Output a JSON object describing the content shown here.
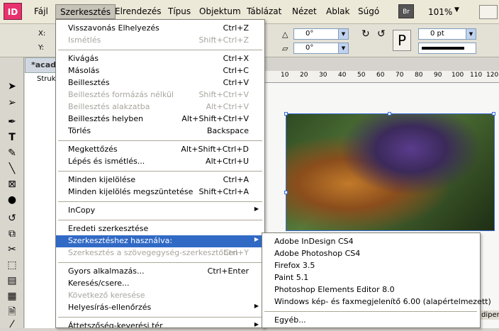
{
  "app": {
    "logo": "ID"
  },
  "menubar": {
    "items": [
      "Fájl",
      "Szerkesztés",
      "Elrendezés",
      "Típus",
      "Objektum",
      "Táblázat",
      "Nézet",
      "Ablak",
      "Súgó"
    ],
    "bridge_label": "Br",
    "zoom": "101%"
  },
  "control_panel": {
    "x_label": "X:",
    "y_label": "Y:",
    "angle1": "0°",
    "angle2": "0°",
    "stroke_weight": "0 pt"
  },
  "document": {
    "tab_title": "*acad",
    "panel_label": "Strukt"
  },
  "ruler": {
    "marks": [
      "10",
      "20",
      "30",
      "40",
      "50",
      "60",
      "70",
      "80",
      "90",
      "100",
      "110",
      "120"
    ]
  },
  "edit_menu": {
    "items": [
      {
        "label": "Visszavonás Elhelyezés",
        "shortcut": "Ctrl+Z",
        "disabled": false
      },
      {
        "label": "Ismétlés",
        "shortcut": "Shift+Ctrl+Z",
        "disabled": true
      },
      {
        "label": "Kivágás",
        "shortcut": "Ctrl+X",
        "disabled": false
      },
      {
        "label": "Másolás",
        "shortcut": "Ctrl+C",
        "disabled": false
      },
      {
        "label": "Beillesztés",
        "shortcut": "Ctrl+V",
        "disabled": false
      },
      {
        "label": "Beillesztés formázás nélkül",
        "shortcut": "Shift+Ctrl+V",
        "disabled": true
      },
      {
        "label": "Beillesztés alakzatba",
        "shortcut": "Alt+Ctrl+V",
        "disabled": true
      },
      {
        "label": "Beillesztés helyben",
        "shortcut": "Alt+Shift+Ctrl+V",
        "disabled": false
      },
      {
        "label": "Törlés",
        "shortcut": "Backspace",
        "disabled": false
      },
      {
        "label": "Megkettőzés",
        "shortcut": "Alt+Shift+Ctrl+D",
        "disabled": false
      },
      {
        "label": "Lépés és ismétlés...",
        "shortcut": "Alt+Ctrl+U",
        "disabled": false
      },
      {
        "label": "Minden kijelölése",
        "shortcut": "Ctrl+A",
        "disabled": false
      },
      {
        "label": "Minden kijelölés megszüntetése",
        "shortcut": "Shift+Ctrl+A",
        "disabled": false
      },
      {
        "label": "InCopy",
        "shortcut": "",
        "disabled": false,
        "submenu": true
      },
      {
        "label": "Eredeti szerkesztése",
        "shortcut": "",
        "disabled": false
      },
      {
        "label": "Szerkesztéshez használva:",
        "shortcut": "",
        "disabled": false,
        "submenu": true,
        "highlight": true
      },
      {
        "label": "Szerkesztés a szövegegység-szerkesztőben",
        "shortcut": "Ctrl+Y",
        "disabled": true
      },
      {
        "label": "Gyors alkalmazás...",
        "shortcut": "Ctrl+Enter",
        "disabled": false
      },
      {
        "label": "Keresés/csere...",
        "shortcut": "",
        "disabled": false
      },
      {
        "label": "Következő keresése",
        "shortcut": "",
        "disabled": true
      },
      {
        "label": "Helyesírás-ellenőrzés",
        "shortcut": "",
        "disabled": false,
        "submenu": true
      },
      {
        "label": "Áttetszőség-keverési tér",
        "shortcut": "",
        "disabled": false,
        "submenu": true
      }
    ]
  },
  "edit_with_submenu": {
    "items": [
      "Adobe InDesign CS4",
      "Adobe Photoshop CS4",
      "Firefox 3.5",
      "Paint 5.1",
      "Photoshop Elements Editor 8.0",
      "Windows kép- és faxmegjelenítő 6.00 (alapértelmezett)",
      "Egyéb..."
    ]
  },
  "right_panel": {
    "label": "diperl"
  }
}
